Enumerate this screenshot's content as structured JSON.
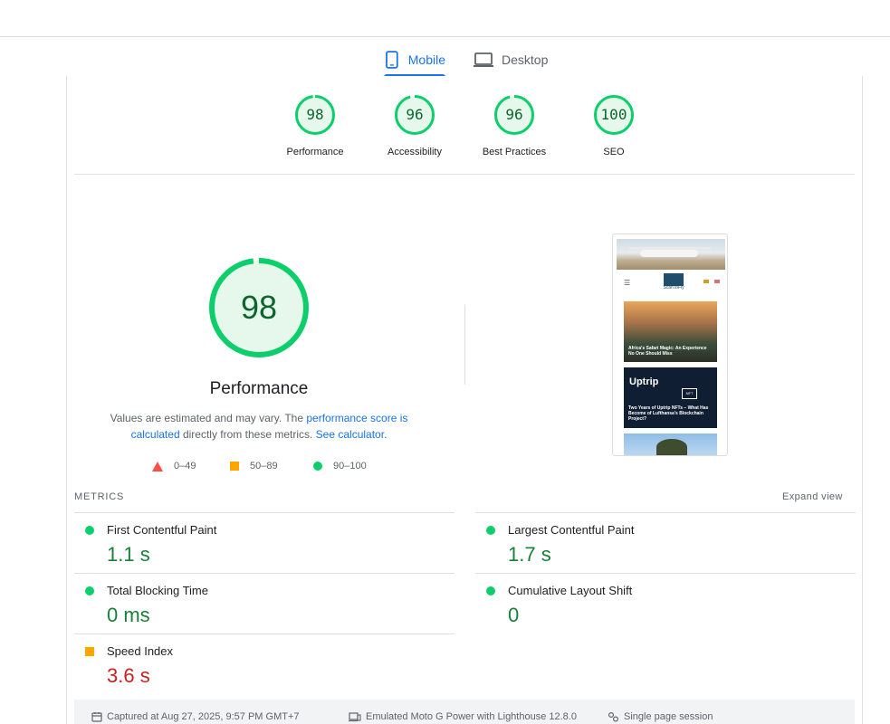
{
  "tabs": [
    {
      "label": "Mobile",
      "icon": "smartphone-icon",
      "active": true
    },
    {
      "label": "Desktop",
      "icon": "laptop-icon",
      "active": false
    }
  ],
  "categories": [
    {
      "score": "98",
      "label": "Performance",
      "fraction": 0.98
    },
    {
      "score": "96",
      "label": "Accessibility",
      "fraction": 0.96
    },
    {
      "score": "96",
      "label": "Best Practices",
      "fraction": 0.96
    },
    {
      "score": "100",
      "label": "SEO",
      "fraction": 1.0
    }
  ],
  "performance": {
    "score": "98",
    "fraction": 0.98,
    "title": "Performance",
    "desc_1": "Values are estimated and may vary. The ",
    "link_1": "performance score is calculated",
    "desc_2": " directly from these metrics. ",
    "link_2": "See calculator",
    "desc_3": "."
  },
  "legend": [
    {
      "range": "0–49",
      "shape": "triangle",
      "color": "#ff4e42"
    },
    {
      "range": "50–89",
      "shape": "square",
      "color": "#ffa400"
    },
    {
      "range": "90–100",
      "shape": "circle",
      "color": "#0cce6b"
    }
  ],
  "screenshot": {
    "logo_text": "ScanToFly",
    "card1_title": "Africa's Safari Magic: An Experience No One Should Miss",
    "card2_brand": "Uptrip",
    "card2_badge": "NFT",
    "card2_title": "Two Years of Uptrip NFTs – What Has Become of Lufthansa's Blockchain Project?"
  },
  "metrics_heading": "METRICS",
  "expand_label": "Expand view",
  "metrics": [
    {
      "name": "First Contentful Paint",
      "value": "1.1 s",
      "status": "good"
    },
    {
      "name": "Largest Contentful Paint",
      "value": "1.7 s",
      "status": "good"
    },
    {
      "name": "Total Blocking Time",
      "value": "0 ms",
      "status": "good"
    },
    {
      "name": "Cumulative Layout Shift",
      "value": "0",
      "status": "good"
    },
    {
      "name": "Speed Index",
      "value": "3.6 s",
      "status": "average"
    }
  ],
  "footer": [
    {
      "icon": "calendar-icon",
      "text": "Captured at Aug 27, 2025, 9:57 PM GMT+7"
    },
    {
      "icon": "device-icon",
      "text": "Emulated Moto G Power with Lighthouse 12.8.0"
    },
    {
      "icon": "session-icon",
      "text": "Single page session"
    }
  ],
  "colors": {
    "accent": "#1a73e8",
    "pass": "#0cce6b",
    "pass_text": "#188038",
    "average": "#ffa400",
    "fail": "#ff4e42"
  }
}
